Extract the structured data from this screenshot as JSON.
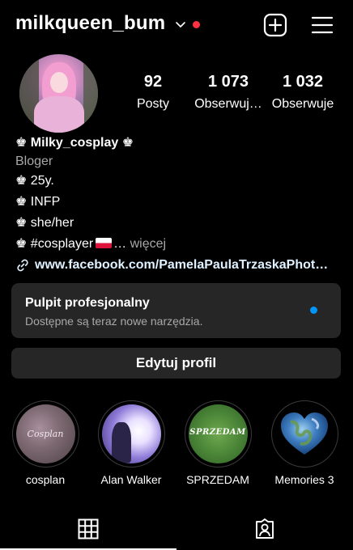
{
  "header": {
    "username": "milkqueen_bum",
    "chevron_icon": "chevron-down-icon",
    "notification_dot_color": "#ff3040",
    "add_icon": "plus-square-icon",
    "menu_icon": "hamburger-menu-icon"
  },
  "profile": {
    "stats": [
      {
        "value": "92",
        "label": "Posty"
      },
      {
        "value": "1 073",
        "label": "Obserwuj…"
      },
      {
        "value": "1 032",
        "label": "Obserwuje"
      }
    ],
    "display_name": "♚ Milky_cosplay ♚",
    "category": "Bloger",
    "bio_lines": [
      "♚ 25y.",
      "♚ INFP",
      "♚ she/her"
    ],
    "bio_last_prefix": "♚ #cosplayer",
    "bio_last_suffix": "…",
    "more_label": "więcej",
    "link": "www.facebook.com/PamelaPaulaTrzaskaPhot…",
    "link_icon": "link-icon"
  },
  "pro_dashboard": {
    "title": "Pulpit profesjonalny",
    "subtitle": "Dostępne są teraz nowe narzędzia.",
    "dot_color": "#0095f6"
  },
  "edit_profile_label": "Edytuj profil",
  "highlights": [
    {
      "label": "cosplan",
      "cover_text": "Cosplan"
    },
    {
      "label": "Alan Walker"
    },
    {
      "label": "SPRZEDAM",
      "cover_text": "SPRZEDAM"
    },
    {
      "label": "Memories 3"
    }
  ],
  "tabs": [
    {
      "name": "grid",
      "icon": "grid-icon",
      "active": true
    },
    {
      "name": "tagged",
      "icon": "tagged-user-icon",
      "active": false
    }
  ]
}
